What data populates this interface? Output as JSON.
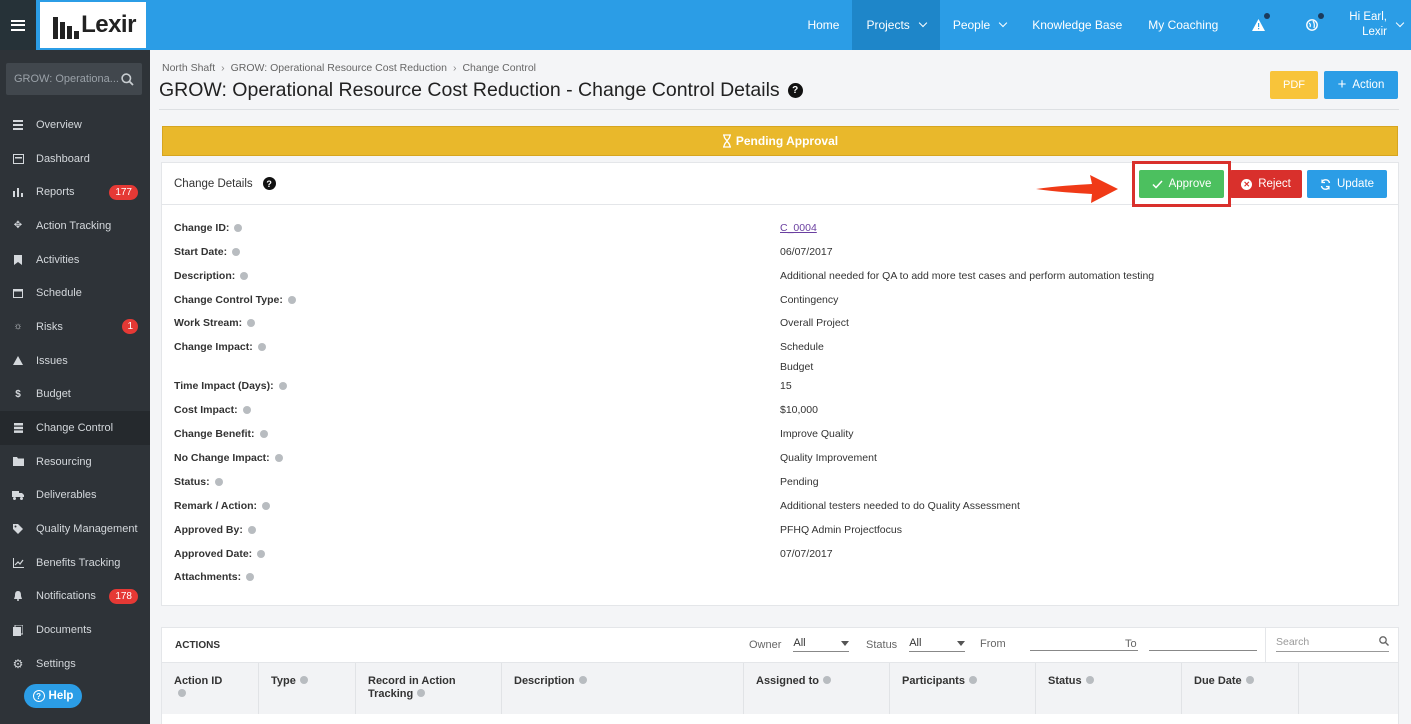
{
  "app": {
    "logo_text": "Lexir"
  },
  "topnav": {
    "items": [
      "Home",
      "Projects",
      "People",
      "Knowledge Base",
      "My Coaching"
    ],
    "user_line1": "Hi Earl,",
    "user_line2": "Lexir"
  },
  "sidebar": {
    "search_value": "GROW: Operationa...",
    "items": [
      {
        "label": "Overview",
        "icon": "overview-icon"
      },
      {
        "label": "Dashboard",
        "icon": "dashboard-icon"
      },
      {
        "label": "Reports",
        "icon": "reports-icon",
        "badge": "177"
      },
      {
        "label": "Action Tracking",
        "icon": "action-tracking-icon"
      },
      {
        "label": "Activities",
        "icon": "bookmark-icon"
      },
      {
        "label": "Schedule",
        "icon": "calendar-icon"
      },
      {
        "label": "Risks",
        "icon": "bulb-icon",
        "badge": "1"
      },
      {
        "label": "Issues",
        "icon": "warning-icon"
      },
      {
        "label": "Budget",
        "icon": "dollar-icon"
      },
      {
        "label": "Change Control",
        "icon": "change-control-icon"
      },
      {
        "label": "Resourcing",
        "icon": "folder-icon"
      },
      {
        "label": "Deliverables",
        "icon": "truck-icon"
      },
      {
        "label": "Quality Management",
        "icon": "tag-icon"
      },
      {
        "label": "Benefits Tracking",
        "icon": "line-chart-icon"
      },
      {
        "label": "Notifications",
        "icon": "bell-icon",
        "badge": "178"
      },
      {
        "label": "Documents",
        "icon": "documents-icon"
      },
      {
        "label": "Settings",
        "icon": "gear-icon"
      }
    ],
    "help_label": "Help"
  },
  "breadcrumb": [
    "North Shaft",
    "GROW: Operational Resource Cost Reduction",
    "Change Control"
  ],
  "page_title": "GROW: Operational Resource Cost Reduction - Change Control Details",
  "header_buttons": {
    "pdf": "PDF",
    "action": "Action"
  },
  "status_banner": "Pending Approval",
  "details": {
    "title": "Change Details",
    "buttons": {
      "approve": "Approve",
      "reject": "Reject",
      "update": "Update"
    },
    "rows": [
      {
        "label": "Change ID:",
        "value": "C_0004"
      },
      {
        "label": "Start Date:",
        "value": "06/07/2017"
      },
      {
        "label": "Description:",
        "value": "Additional needed for QA to add more test cases and perform automation testing"
      },
      {
        "label": "Change Control Type:",
        "value": "Contingency"
      },
      {
        "label": "Work Stream:",
        "value": "Overall Project"
      },
      {
        "label": "Change Impact:",
        "value": "Schedule",
        "value2": "Budget"
      },
      {
        "label": "Time Impact (Days):",
        "value": "15"
      },
      {
        "label": "Cost Impact:",
        "value": "$10,000"
      },
      {
        "label": "Change Benefit:",
        "value": "Improve Quality"
      },
      {
        "label": "No Change Impact:",
        "value": "Quality Improvement"
      },
      {
        "label": "Status:",
        "value": "Pending"
      },
      {
        "label": "Remark / Action:",
        "value": "Additional testers needed to do Quality Assessment"
      },
      {
        "label": "Approved By:",
        "value": "PFHQ Admin Projectfocus"
      },
      {
        "label": "Approved Date:",
        "value": "07/07/2017"
      },
      {
        "label": "Attachments:",
        "value": ""
      }
    ]
  },
  "actions": {
    "title": "ACTIONS",
    "owner_label": "Owner",
    "owner_value": "All",
    "status_label": "Status",
    "status_value": "All",
    "from_label": "From",
    "to_label": "To",
    "search_placeholder": "Search",
    "columns": [
      "Action ID",
      "Type",
      "Record in Action Tracking",
      "Description",
      "Assigned to",
      "Participants",
      "Status",
      "Due Date"
    ]
  }
}
